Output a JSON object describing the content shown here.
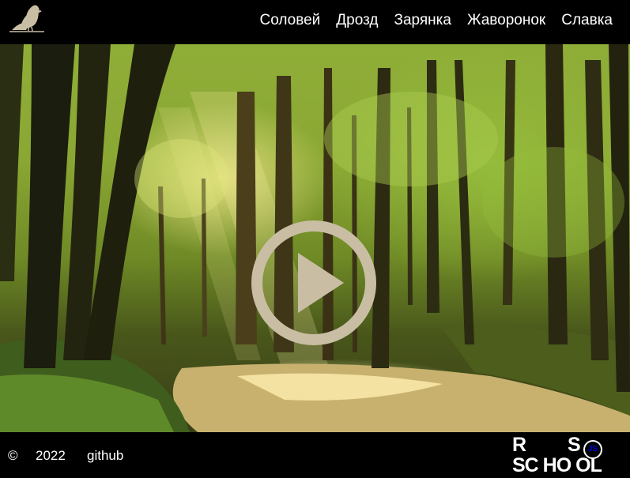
{
  "header": {
    "logo_icon": "bird-logo-icon",
    "nav": [
      {
        "label": "Соловей"
      },
      {
        "label": "Дрозд"
      },
      {
        "label": "Зарянка"
      },
      {
        "label": "Жаворонок"
      },
      {
        "label": "Славка"
      }
    ]
  },
  "main": {
    "background": "forest-scene-image",
    "play_button_icon": "play-icon",
    "play_button_color": "#c9bea4"
  },
  "footer": {
    "copyright": "©",
    "year": "2022",
    "github_label": "github",
    "school_logo": {
      "line1_left": "R",
      "line1_right": "S",
      "badge": "JS",
      "line2": "SC HO OL"
    }
  }
}
